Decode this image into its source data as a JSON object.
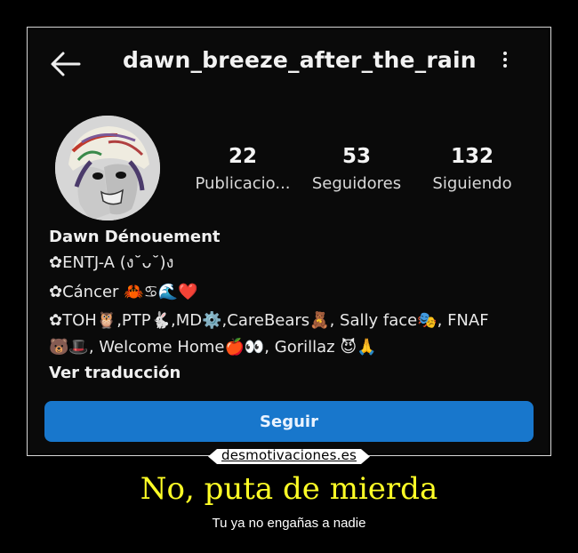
{
  "profile": {
    "username": "dawn_breeze_after_the_rain",
    "stats": [
      {
        "value": "22",
        "label": "Publicacio..."
      },
      {
        "value": "53",
        "label": "Seguidores"
      },
      {
        "value": "132",
        "label": "Siguiendo"
      }
    ],
    "name": "Dawn Dénouement",
    "bio_lines": [
      "✿ENTJ-A (ง˘ᴗ˘)ง",
      "✿Cáncer 🦀♋🌊❤️",
      "✿TOH🦉,PTP🐇,MD⚙️,CareBears🧸, Sally face🎭, FNAF",
      "🐻🎩, Welcome Home🍎👀, Gorillaz 😈🙏"
    ],
    "translate_label": "Ver traducción",
    "follow_label": "Seguir"
  },
  "icons": {
    "back": "arrow-left-icon",
    "menu": "more-vertical-icon"
  },
  "colors": {
    "follow_button": "#1877cc",
    "caption_title": "#ffff26"
  },
  "poster": {
    "watermark": "desmotivaciones.es",
    "title": "No, puta de mierda",
    "subtitle": "Tu ya no engañas a nadie"
  }
}
